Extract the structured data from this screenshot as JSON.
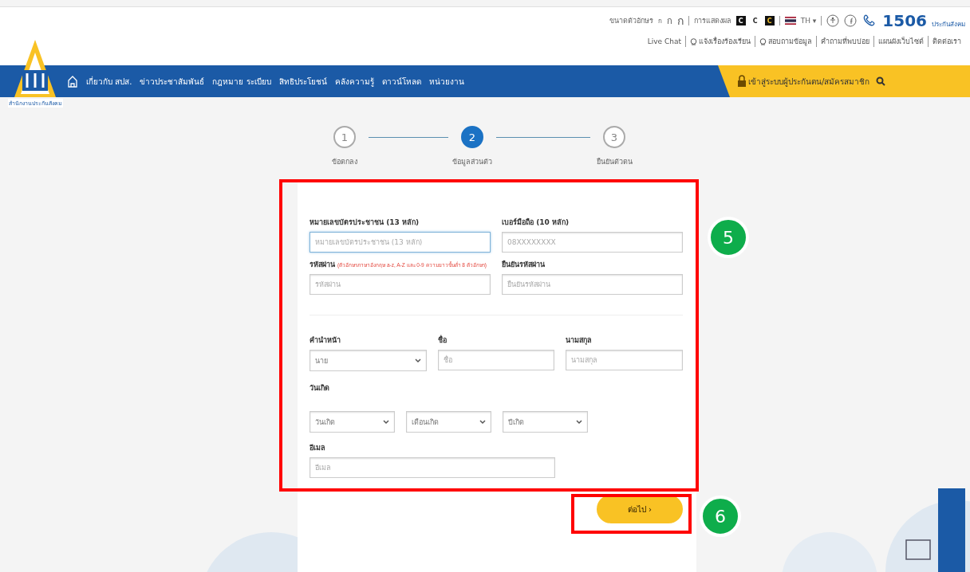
{
  "top_bar": {
    "font_size_label": "ขนาดตัวอักษร",
    "font_sizes": [
      "ก",
      "ก",
      "ก"
    ],
    "display_label": "การแสดงผล",
    "contrast_options": [
      {
        "label": "C",
        "kind": "dark"
      },
      {
        "label": "C",
        "kind": "light"
      },
      {
        "label": "C",
        "kind": "yellow"
      }
    ],
    "language": "TH ▾",
    "hotline": "1506",
    "hotline_caption": "ประกันสังคม"
  },
  "quick_links": [
    {
      "label": "Live Chat",
      "kind": "plain"
    },
    {
      "label": "แจ้งเรื่องร้องเรียน",
      "kind": "chat"
    },
    {
      "label": "สอบถามข้อมูล",
      "kind": "chat"
    },
    {
      "label": "คำถามที่พบบ่อย",
      "kind": "plain"
    },
    {
      "label": "แผนผังเว็บไซต์",
      "kind": "plain"
    },
    {
      "label": "ติดต่อเรา",
      "kind": "plain"
    }
  ],
  "logo_caption": "สำนักงานประกันสังคม",
  "nav": {
    "items": [
      "เกี่ยวกับ สปส.",
      "ข่าวประชาสัมพันธ์",
      "กฎหมาย ระเบียบ",
      "สิทธิประโยชน์",
      "คลังความรู้",
      "ดาวน์โหลด",
      "หน่วยงาน"
    ],
    "login": "เข้าสู่ระบบผู้ประกันตน/สมัครสมาชิก"
  },
  "steps": [
    {
      "number": "1",
      "label": "ข้อตกลง",
      "selected": false
    },
    {
      "number": "2",
      "label": "ข้อมูลส่วนตัว",
      "selected": true
    },
    {
      "number": "3",
      "label": "ยืนยันตัวตน",
      "selected": false
    }
  ],
  "form": {
    "account": [
      {
        "label": "หมายเลขบัตรประชาชน (13 หลัก)",
        "placeholder": "หมายเลขบัตรประชาชน (13 หลัก)",
        "focused": true
      },
      {
        "label": "เบอร์มือถือ (10 หลัก)",
        "placeholder": "08XXXXXXXX",
        "focused": false
      },
      {
        "label": "รหัสผ่าน",
        "hint": "(ตัวอักษรภาษาอังกฤษ a-z, A-Z และ 0-9 ความยาวขั้นต่ำ 8 ตัวอักษร)",
        "placeholder": "รหัสผ่าน",
        "focused": false
      },
      {
        "label": "ยืนยันรหัสผ่าน",
        "placeholder": "ยืนยันรหัสผ่าน",
        "focused": false
      }
    ],
    "name_row": [
      {
        "label": "คำนำหน้า",
        "kind": "select",
        "value": "นาย"
      },
      {
        "label": "ชื่อ",
        "kind": "text",
        "placeholder": "ชื่อ"
      },
      {
        "label": "นามสกุล",
        "kind": "text",
        "placeholder": "นามสกุล"
      }
    ],
    "birth_label": "วันเกิด",
    "birth_selects": [
      "วันเกิด",
      "เดือนเกิด",
      "ปีเกิด"
    ],
    "email": {
      "label": "อีเมล",
      "placeholder": "อีเมล"
    }
  },
  "next_button": "ต่อไป ›",
  "annotations": [
    "5",
    "6"
  ]
}
